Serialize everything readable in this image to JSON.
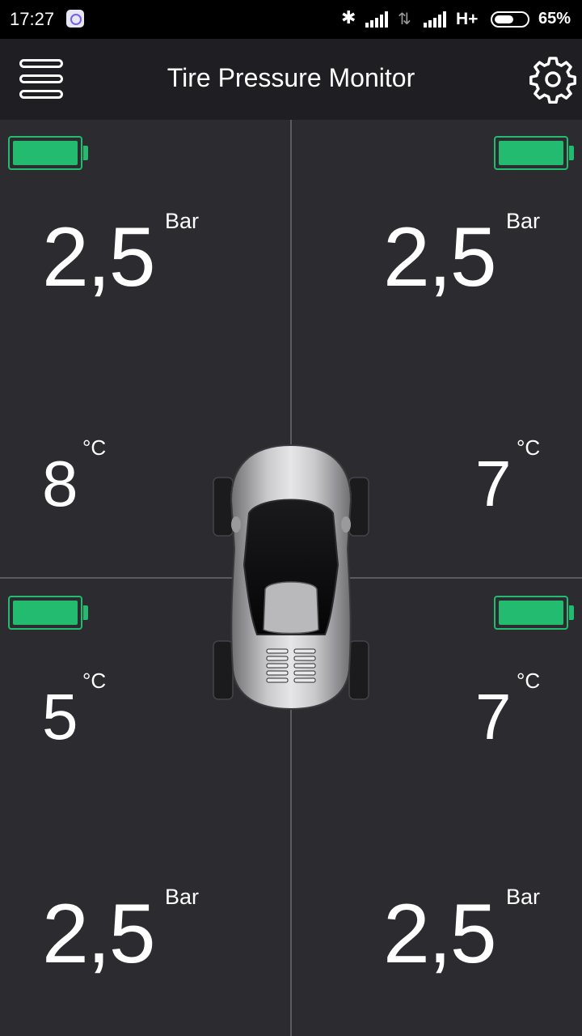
{
  "status_bar": {
    "time": "17:27",
    "viber_icon": "viber-icon",
    "bluetooth_icon": "bluetooth-icon",
    "network": "H+",
    "battery_level": 0.65,
    "battery_percent": "65%"
  },
  "app_bar": {
    "title": "Tire Pressure Monitor",
    "menu_icon": "menu-icon",
    "settings_icon": "gear-icon"
  },
  "tires": {
    "front_left": {
      "pressure": "2,5",
      "pressure_unit": "Bar",
      "temperature": "8",
      "temperature_unit": "°C",
      "battery_level": 1.0
    },
    "front_right": {
      "pressure": "2,5",
      "pressure_unit": "Bar",
      "temperature": "7",
      "temperature_unit": "°C",
      "battery_level": 1.0
    },
    "rear_left": {
      "pressure": "2,5",
      "pressure_unit": "Bar",
      "temperature": "5",
      "temperature_unit": "°C",
      "battery_level": 1.0
    },
    "rear_right": {
      "pressure": "2,5",
      "pressure_unit": "Bar",
      "temperature": "7",
      "temperature_unit": "°C",
      "battery_level": 1.0
    }
  },
  "colors": {
    "battery_ok": "#22bb6f",
    "background": "#2b2b30",
    "app_bar": "#1f1f23"
  }
}
